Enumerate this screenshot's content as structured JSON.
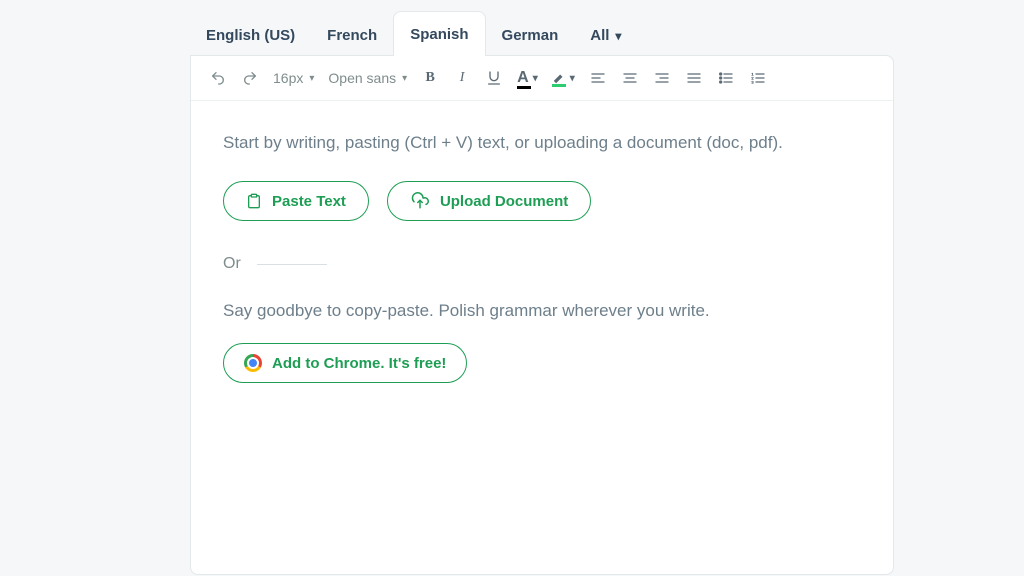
{
  "tabs": {
    "items": [
      "English (US)",
      "French",
      "Spanish",
      "German",
      "All"
    ],
    "active_index": 2
  },
  "toolbar": {
    "font_size": "16px",
    "font_family": "Open sans"
  },
  "content": {
    "hint": "Start by writing, pasting (Ctrl + V) text, or uploading a document (doc, pdf).",
    "paste_label": "Paste Text",
    "upload_label": "Upload Document",
    "or_label": "Or",
    "sub": "Say goodbye to copy-paste. Polish grammar wherever you write.",
    "chrome_label": "Add to Chrome. It's free!"
  },
  "colors": {
    "accent": "#1e9e54"
  }
}
